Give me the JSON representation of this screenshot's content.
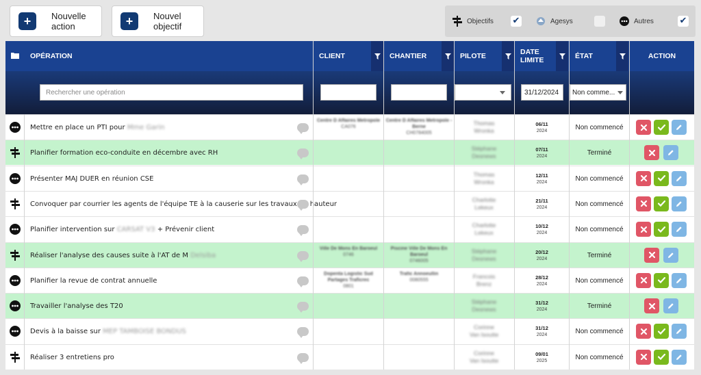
{
  "toolbar": {
    "new_action_line1": "Nouvelle",
    "new_action_line2": "action",
    "new_objective_line1": "Nouvel",
    "new_objective_line2": "objectif",
    "plus_symbol": "+"
  },
  "filters": {
    "objectifs_label": "Objectifs",
    "objectifs_checked": true,
    "agesys_label": "Agesys",
    "agesys_checked": false,
    "autres_label": "Autres",
    "autres_checked": true
  },
  "columns": {
    "operation": "OPÉRATION",
    "client": "CLIENT",
    "chantier": "CHANTIER",
    "pilote": "PILOTE",
    "date_limite_1": "DATE",
    "date_limite_2": "LIMITE",
    "etat": "ÉTAT",
    "action": "ACTION"
  },
  "filter_row": {
    "search_placeholder": "Rechercher une opération",
    "date_value": "31/12/2024",
    "etat_value": "Non comme..."
  },
  "rows": [
    {
      "type": "autres",
      "op": "Mettre en place un PTI pour ",
      "op_blur": "Mme Garin",
      "op_after": "",
      "client": "Centre D Affaires Metropole",
      "client2": "CA076",
      "chantier": "Centre D Affaires Metropole - Berne",
      "chantier2": "CH0784005",
      "pilote1": "Thomas",
      "pilote2": "Wronka",
      "date": "06/11",
      "year": "2024",
      "etat": "Non commencé",
      "done": false
    },
    {
      "type": "objectif",
      "op": "Planifier formation eco-conduite en décembre avec RH",
      "op_blur": "",
      "op_after": "",
      "client": "",
      "client2": "",
      "chantier": "",
      "chantier2": "",
      "pilote1": "Stéphane",
      "pilote2": "Desnews",
      "date": "07/11",
      "year": "2024",
      "etat": "Terminé",
      "done": true
    },
    {
      "type": "autres",
      "op": "Présenter MAJ DUER en réunion CSE",
      "op_blur": "",
      "op_after": "",
      "client": "",
      "client2": "",
      "chantier": "",
      "chantier2": "",
      "pilote1": "Thomas",
      "pilote2": "Wronka",
      "date": "12/11",
      "year": "2024",
      "etat": "Non commencé",
      "done": false
    },
    {
      "type": "objectif",
      "op": "Convoquer par courrier les agents de l'équipe TE à la causerie sur les travaux en hauteur",
      "op_blur": "",
      "op_after": "",
      "client": "",
      "client2": "",
      "chantier": "",
      "chantier2": "",
      "pilote1": "Charlotte",
      "pilote2": "Lekeux",
      "date": "21/11",
      "year": "2024",
      "etat": "Non commencé",
      "done": false
    },
    {
      "type": "autres",
      "op": "Planifier intervention sur ",
      "op_blur": "CARSAT V3",
      "op_after": " + Prévenir client",
      "client": "",
      "client2": "",
      "chantier": "",
      "chantier2": "",
      "pilote1": "Charlotte",
      "pilote2": "Lekeux",
      "date": "10/12",
      "year": "2024",
      "etat": "Non commencé",
      "done": false
    },
    {
      "type": "objectif",
      "op": "Réaliser l'analyse des causes suite à l'AT de M ",
      "op_blur": "Delsiba",
      "op_after": "",
      "client": "Ville De Mons En Baroeul",
      "client2": "0746",
      "chantier": "Piscine Ville De Mons En Baroeul",
      "chantier2": "0746005",
      "pilote1": "Stéphane",
      "pilote2": "Desnews",
      "date": "20/12",
      "year": "2024",
      "etat": "Terminé",
      "done": true
    },
    {
      "type": "autres",
      "op": "Planifier la revue de contrat annuelle",
      "op_blur": "",
      "op_after": "",
      "client": "Dopenta Logistic Sud Partages Traficrec",
      "client2": "0801",
      "chantier": "Trafic Annoeullin",
      "chantier2": "0080555",
      "pilote1": "Francois",
      "pilote2": "Brenz",
      "date": "28/12",
      "year": "2024",
      "etat": "Non commencé",
      "done": false
    },
    {
      "type": "autres",
      "op": "Travailler l'analyse des T20",
      "op_blur": "",
      "op_after": "",
      "client": "",
      "client2": "",
      "chantier": "",
      "chantier2": "",
      "pilote1": "Stéphane",
      "pilote2": "Desnews",
      "date": "31/12",
      "year": "2024",
      "etat": "Terminé",
      "done": true
    },
    {
      "type": "autres",
      "op": "Devis à la baisse sur ",
      "op_blur": "MEP TAMBOISE BONDUS",
      "op_after": "",
      "client": "",
      "client2": "",
      "chantier": "",
      "chantier2": "",
      "pilote1": "Corinne",
      "pilote2": "Van Isoutte",
      "date": "31/12",
      "year": "2024",
      "etat": "Non commencé",
      "done": false
    },
    {
      "type": "objectif",
      "op": "Réaliser 3 entretiens pro",
      "op_blur": "",
      "op_after": "",
      "client": "",
      "client2": "",
      "chantier": "",
      "chantier2": "",
      "pilote1": "Corinne",
      "pilote2": "Van Isoutte",
      "date": "09/01",
      "year": "2025",
      "etat": "Non commencé",
      "done": false
    }
  ],
  "icons": {
    "objectif": "signpost-icon",
    "autres": "more-dots-icon",
    "agesys": "agesys-logo-icon",
    "comment": "comment-icon"
  },
  "colors": {
    "header_bg": "#1a4291",
    "done_row": "#c4f3cd",
    "delete": "#e05666",
    "validate": "#7ab91d",
    "edit": "#7fb6e4",
    "brand_button": "#123a73"
  }
}
